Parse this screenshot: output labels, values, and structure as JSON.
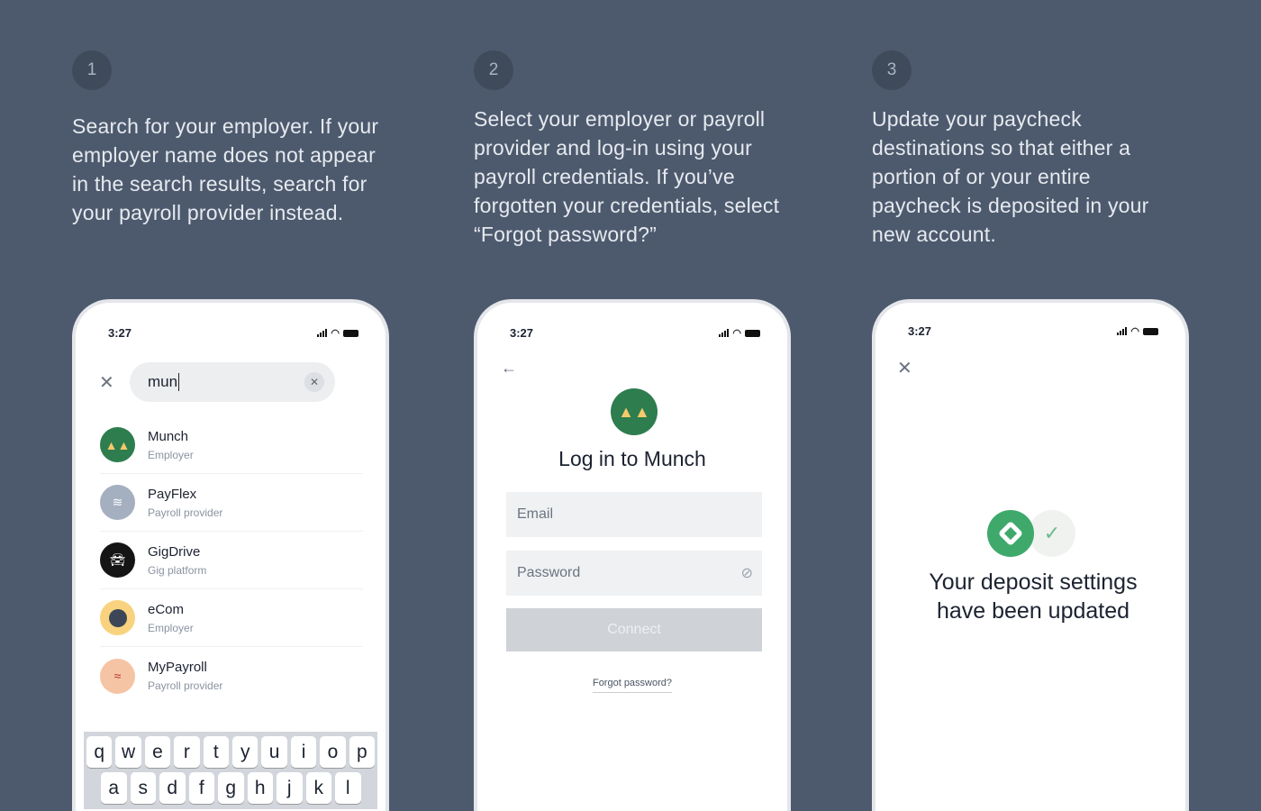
{
  "steps": [
    {
      "number": "1",
      "text": "Search for your employer. If your employer name does not appear in the search results, search for your payroll provider instead."
    },
    {
      "number": "2",
      "text": "Select your employer or payroll provider and log-in using your payroll credentials. If you’ve forgotten your credentials, select “Forgot password?”"
    },
    {
      "number": "3",
      "text": "Update your paycheck destinations so that either a portion of or your entire paycheck is deposited in your new account."
    }
  ],
  "time": "3:27",
  "search": {
    "value": "mun",
    "results": [
      {
        "name": "Munch",
        "type": "Employer",
        "color": "#2e7d4f"
      },
      {
        "name": "PayFlex",
        "type": "Payroll provider",
        "color": "#a4afc0"
      },
      {
        "name": "GigDrive",
        "type": "Gig platform",
        "color": "#151515"
      },
      {
        "name": "eCom",
        "type": "Employer",
        "color": "#f8d27e"
      },
      {
        "name": "MyPayroll",
        "type": "Payroll provider",
        "color": "#f5c4a4"
      }
    ]
  },
  "keyboard": {
    "row1": [
      "q",
      "w",
      "e",
      "r",
      "t",
      "y",
      "u",
      "i",
      "o",
      "p"
    ],
    "row2": [
      "a",
      "s",
      "d",
      "f",
      "g",
      "h",
      "j",
      "k",
      "l"
    ]
  },
  "login": {
    "title": "Log in to Munch",
    "email_placeholder": "Email",
    "password_placeholder": "Password",
    "connect": "Connect",
    "forgot": "Forgot password?"
  },
  "done": {
    "message": "Your deposit settings have been updated"
  }
}
